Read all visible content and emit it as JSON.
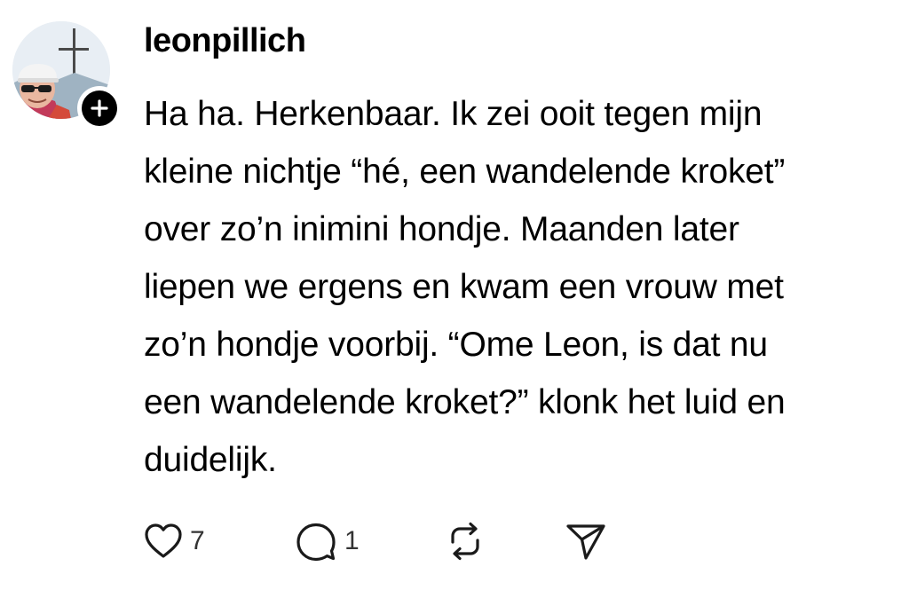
{
  "post": {
    "author": {
      "username": "leonpillich",
      "avatar_icon": "profile-photo",
      "follow_icon": "plus-icon"
    },
    "text": "Ha ha. Herkenbaar. Ik zei ooit tegen mijn\nkleine nichtje “hé, een wandelende kroket”\nover zo’n inimini hondje. Maanden later\nliepen we ergens en kwam een vrouw met\nzo’n hondje voorbij. “Ome Leon, is dat nu\neen wandelende kroket?” klonk het luid en\nduidelijk.",
    "actions": {
      "like": {
        "icon": "heart-icon",
        "count": "7"
      },
      "reply": {
        "icon": "comment-icon",
        "count": "1"
      },
      "repost": {
        "icon": "repost-icon"
      },
      "share": {
        "icon": "send-icon"
      }
    }
  },
  "colors": {
    "text": "#000000",
    "background": "#ffffff",
    "count": "#333333"
  }
}
